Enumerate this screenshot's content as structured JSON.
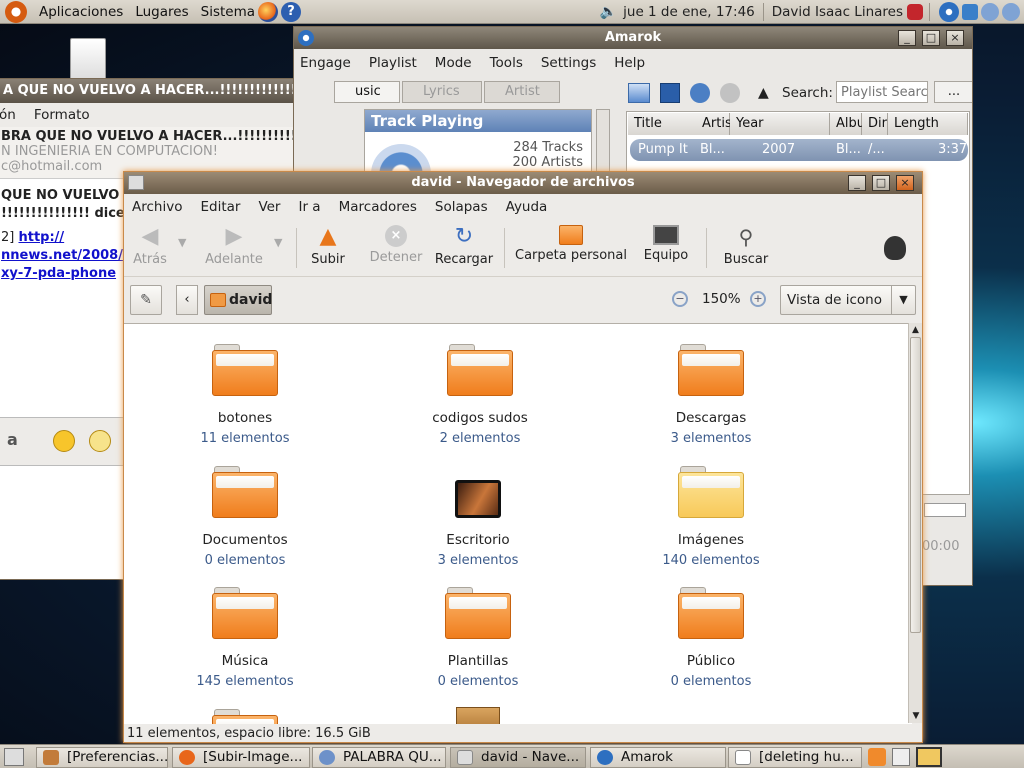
{
  "top_panel": {
    "menus": [
      "Aplicaciones",
      "Lugares",
      "Sistema"
    ],
    "clock": "jue  1 de ene, 17:46",
    "user": "David Isaac Linares"
  },
  "chat_window": {
    "title": "A QUE NO VUELVO A HACER...!!!!!!!!!!!!!!!",
    "menu": [
      "ón",
      "Formato"
    ],
    "header_name": "BRA QUE NO VUELVO A HACER...!!!!!!!!!!!!!!!",
    "header_status": "N INGENIERIA EN COMPUTACION!",
    "header_email": "c@hotmail.com",
    "msg_line1": "QUE NO VUELVO",
    "msg_line2": "!!!!!!!!!!!!!!! dice",
    "msg_prefix": "2]",
    "link1": "http://",
    "link2": "nnews.net/2008/",
    "link3": "xy-7-pda-phone"
  },
  "amarok": {
    "title": "Amarok",
    "menu": [
      "Engage",
      "Playlist",
      "Mode",
      "Tools",
      "Settings",
      "Help"
    ],
    "tabs": [
      "usic",
      "Lyrics",
      "Artist"
    ],
    "now_playing": "Track Playing",
    "stats": [
      "284 Tracks",
      "200 Artists"
    ],
    "search_label": "Search:",
    "search_placeholder": "Playlist Search",
    "more": "...",
    "columns": [
      "Title",
      "Artis",
      "Year",
      "Albu",
      "Dir",
      "Length"
    ],
    "row": {
      "title": "Pump It",
      "artist": "Bl...",
      "year": "2007",
      "album": "Bl...",
      "dir": "/...",
      "length": "3:37"
    },
    "time": "00:00"
  },
  "nautilus": {
    "title": "david - Navegador de archivos",
    "menu": [
      "Archivo",
      "Editar",
      "Ver",
      "Ir a",
      "Marcadores",
      "Solapas",
      "Ayuda"
    ],
    "toolbar": {
      "back": "Atrás",
      "forward": "Adelante",
      "up": "Subir",
      "stop": "Detener",
      "reload": "Recargar",
      "home": "Carpeta personal",
      "computer": "Equipo",
      "search": "Buscar"
    },
    "location": "david",
    "zoom": "150%",
    "view_mode": "Vista de icono",
    "items": [
      {
        "name": "botones",
        "count": "11 elementos"
      },
      {
        "name": "codigos sudos",
        "count": "2 elementos"
      },
      {
        "name": "Descargas",
        "count": "3 elementos"
      },
      {
        "name": "Documentos",
        "count": "0 elementos"
      },
      {
        "name": "Escritorio",
        "count": "3 elementos"
      },
      {
        "name": "Imágenes",
        "count": "140 elementos"
      },
      {
        "name": "Música",
        "count": "145 elementos"
      },
      {
        "name": "Plantillas",
        "count": "0 elementos"
      },
      {
        "name": "Público",
        "count": "0 elementos"
      }
    ],
    "status": "11 elementos, espacio libre: 16.5 GiB"
  },
  "taskbar": [
    "[Preferencias...",
    "[Subir-Image...",
    "PALABRA QU...",
    "david - Nave...",
    "Amarok",
    "[deleting hu..."
  ],
  "colors": {
    "accent": "#f07d1c",
    "selection": "#8fa3bf",
    "link": "#1111cc"
  }
}
